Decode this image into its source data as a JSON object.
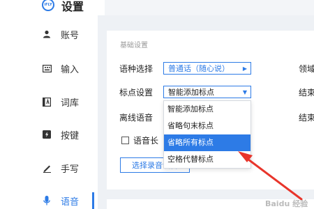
{
  "app": {
    "title": "设置",
    "logo_text": "iFLY"
  },
  "sidebar": {
    "items": [
      {
        "label": "账号",
        "icon": "user-icon"
      },
      {
        "label": "输入",
        "icon": "keyboard-icon"
      },
      {
        "label": "词库",
        "icon": "dictionary-icon"
      },
      {
        "label": "按键",
        "icon": "key-icon"
      },
      {
        "label": "手写",
        "icon": "pen-icon"
      },
      {
        "label": "语音",
        "icon": "microphone-icon",
        "active": true
      }
    ]
  },
  "basic": {
    "section_title": "基础设置",
    "language_label": "语种选择",
    "language_value": "普通话（随心说）",
    "punct_label": "标点设置",
    "punct_value": "智能添加标点",
    "offline_label": "离线语音",
    "checkbox_label": "语音长",
    "select_button": "选择录音设备"
  },
  "dropdown": {
    "options": [
      "智能添加标点",
      "省略句末标点",
      "省略所有标点",
      "空格代替标点"
    ],
    "highlighted": "省略所有标点"
  },
  "right_column": {
    "labels": [
      "领域",
      "结束",
      "结束"
    ]
  },
  "watermark": "Baidu 经验",
  "colors": {
    "accent": "#2d7be6",
    "annotation_arrow": "#e8352b",
    "content_bg": "#eef1f5"
  }
}
